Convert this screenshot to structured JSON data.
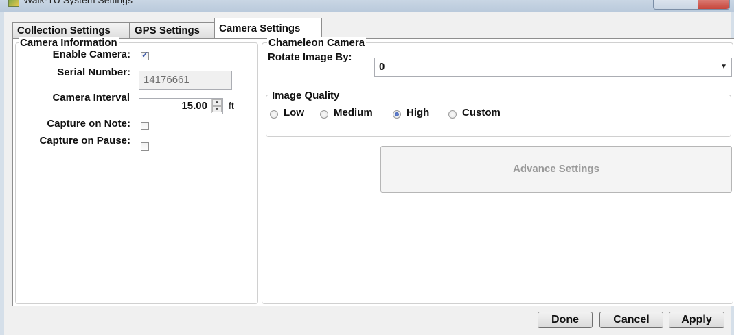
{
  "window": {
    "title": "Walk-TU System Settings"
  },
  "tabs": [
    {
      "label": "Collection Settings",
      "active": false
    },
    {
      "label": "GPS Settings",
      "active": false
    },
    {
      "label": "Camera Settings",
      "active": true
    }
  ],
  "camera_info": {
    "group_title": "Camera Information",
    "enable_camera_label": "Enable Camera:",
    "enable_camera_checked": true,
    "serial_number_label": "Serial Number:",
    "serial_number_value": "14176661",
    "camera_interval_label": "Camera Interval",
    "camera_interval_value": "15.00",
    "camera_interval_unit": "ft",
    "capture_on_note_label": "Capture on Note:",
    "capture_on_note_checked": false,
    "capture_on_pause_label": "Capture on Pause:",
    "capture_on_pause_checked": false
  },
  "chameleon": {
    "group_title": "Chameleon Camera",
    "rotate_label": "Rotate Image By:",
    "rotate_value": "0",
    "quality": {
      "group_title": "Image Quality",
      "options": [
        "Low",
        "Medium",
        "High",
        "Custom"
      ],
      "selected": "High"
    },
    "advance_settings_label": "Advance Settings"
  },
  "footer": {
    "done_label": "Done",
    "cancel_label": "Cancel",
    "apply_label": "Apply"
  }
}
